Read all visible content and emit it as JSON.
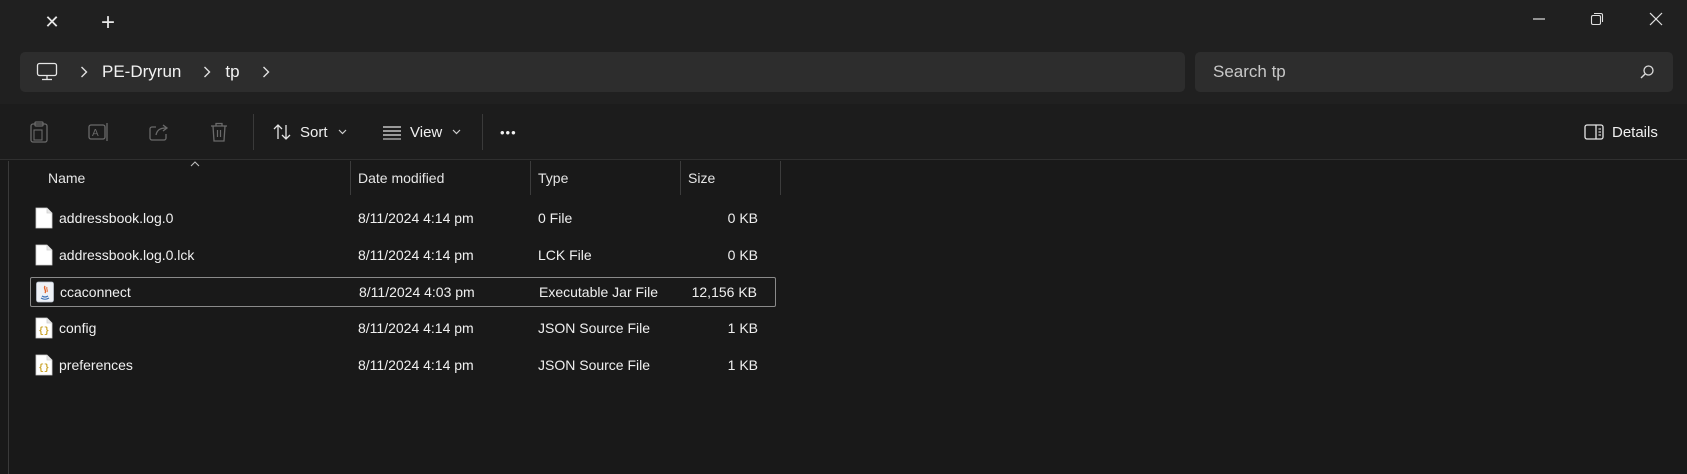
{
  "titlebar": {
    "close_tab_glyph": "✕",
    "new_tab_glyph": "+"
  },
  "address": {
    "crumbs": [
      "PE-Dryrun",
      "tp"
    ]
  },
  "search": {
    "placeholder": "Search tp"
  },
  "toolbar": {
    "sort_label": "Sort",
    "view_label": "View",
    "more_glyph": "•••",
    "details_label": "Details"
  },
  "columns": {
    "name": "Name",
    "date": "Date modified",
    "type": "Type",
    "size": "Size"
  },
  "files": [
    {
      "name": "addressbook.log.0",
      "date": "8/11/2024 4:14 pm",
      "type": "0 File",
      "size": "0 KB",
      "icon": "file-icon"
    },
    {
      "name": "addressbook.log.0.lck",
      "date": "8/11/2024 4:14 pm",
      "type": "LCK File",
      "size": "0 KB",
      "icon": "file-icon"
    },
    {
      "name": "ccaconnect",
      "date": "8/11/2024 4:03 pm",
      "type": "Executable Jar File",
      "size": "12,156 KB",
      "icon": "java-jar-icon"
    },
    {
      "name": "config",
      "date": "8/11/2024 4:14 pm",
      "type": "JSON Source File",
      "size": "1 KB",
      "icon": "json-file-icon"
    },
    {
      "name": "preferences",
      "date": "8/11/2024 4:14 pm",
      "type": "JSON Source File",
      "size": "1 KB",
      "icon": "json-file-icon"
    }
  ],
  "colors": {
    "background": "#191919",
    "chrome": "#202020",
    "field": "#2d2d2d",
    "text": "#f0f0f0",
    "selection_border": "#8a8a8a"
  }
}
